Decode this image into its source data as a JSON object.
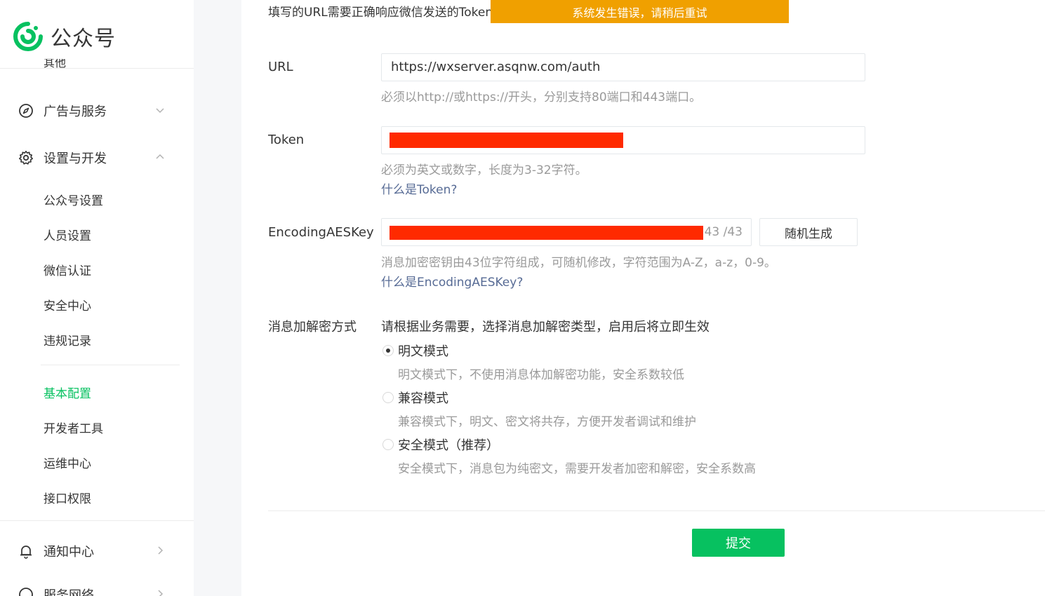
{
  "brand": {
    "name": "公众号"
  },
  "sidebar": {
    "clipped_item": "其他",
    "groups": [
      {
        "label": "广告与服务",
        "icon": "compass-icon",
        "chevron": "chevron-down-icon"
      },
      {
        "label": "设置与开发",
        "icon": "gear-icon",
        "chevron": "chevron-up-icon"
      },
      {
        "label": "通知中心",
        "icon": "bell-icon",
        "chevron": "chevron-right-icon"
      },
      {
        "label": "服务网络",
        "icon": "circle-icon",
        "chevron": "chevron-right-icon"
      }
    ],
    "sub_items": [
      {
        "label": "公众号设置"
      },
      {
        "label": "人员设置"
      },
      {
        "label": "微信认证"
      },
      {
        "label": "安全中心"
      },
      {
        "label": "违规记录"
      },
      {
        "label": "基本配置",
        "active": true
      },
      {
        "label": "开发者工具"
      },
      {
        "label": "运维中心"
      },
      {
        "label": "接口权限"
      }
    ]
  },
  "main": {
    "intro_text": "填写的URL需要正确响应微信发送的Token验证",
    "toast": "系统发生错误，请稍后重试",
    "url": {
      "label": "URL",
      "value": "https://wxserver.asqnw.com/auth",
      "hint": "必须以http://或https://开头，分别支持80端口和443端口。"
    },
    "token": {
      "label": "Token",
      "hint": "必须为英文或数字，长度为3-32字符。",
      "link": "什么是Token?"
    },
    "aeskey": {
      "label": "EncodingAESKey",
      "counter": "43 /43",
      "random_button": "随机生成",
      "hint": "消息加密密钥由43位字符组成，可随机修改，字符范围为A-Z，a-z，0-9。",
      "link": "什么是EncodingAESKey?"
    },
    "encryption": {
      "label": "消息加解密方式",
      "intro": "请根据业务需要，选择消息加解密类型，启用后将立即生效",
      "options": [
        {
          "label": "明文模式",
          "desc": "明文模式下，不使用消息体加解密功能，安全系数较低",
          "checked": true
        },
        {
          "label": "兼容模式",
          "desc": "兼容模式下，明文、密文将共存，方便开发者调试和维护",
          "checked": false
        },
        {
          "label": "安全模式（推荐）",
          "desc": "安全模式下，消息包为纯密文，需要开发者加密和解密，安全系数高",
          "checked": false
        }
      ]
    },
    "submit": "提交"
  },
  "colors": {
    "accent": "#07c160",
    "toast": "#f0a000",
    "redaction": "#ff2a00",
    "link": "#576b95",
    "hint": "#9a9a9a"
  }
}
